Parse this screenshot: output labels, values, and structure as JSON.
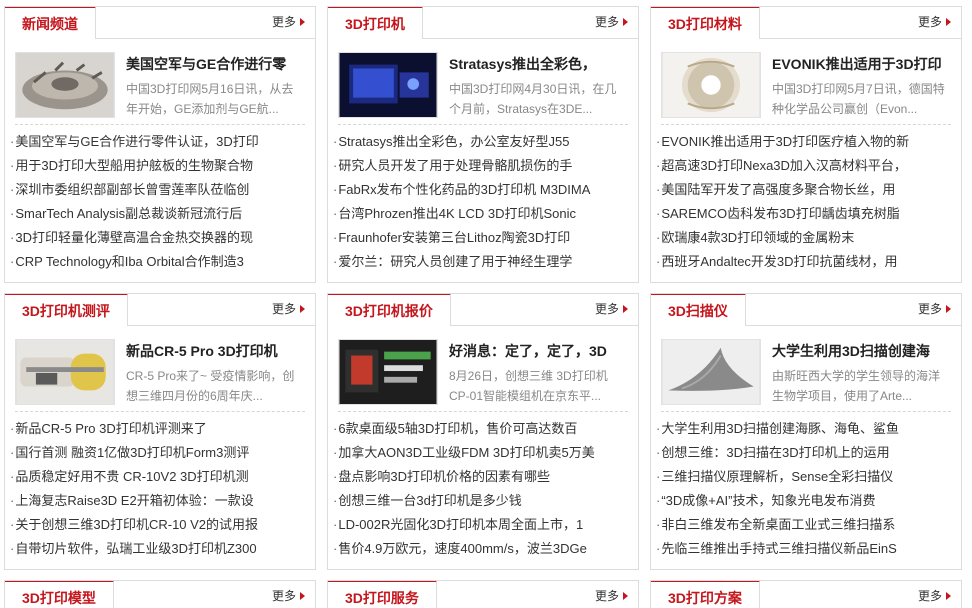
{
  "more_label": "更多",
  "panels": [
    {
      "title": "新闻频道",
      "feature": {
        "title": "美国空军与GE合作进行零",
        "summary": "中国3D打印网5月16日讯，从去年开始，GE添加剂与GE航..."
      },
      "items": [
        "美国空军与GE合作进行零件认证，3D打印",
        "用于3D打印大型船用护舷板的生物聚合物",
        "深圳市委组织部副部长曾雪莲率队莅临创",
        "SmarTech Analysis副总裁谈新冠流行后",
        "3D打印轻量化薄壁高温合金热交换器的现",
        "CRP Technology和Iba Orbital合作制造3"
      ]
    },
    {
      "title": "3D打印机",
      "feature": {
        "title": "Stratasys推出全彩色，",
        "summary": "中国3D打印网4月30日讯，在几个月前，Stratasys在3DE..."
      },
      "items": [
        "Stratasys推出全彩色，办公室友好型J55",
        "研究人员开发了用于处理骨骼肌损伤的手",
        "FabRx发布个性化药品的3D打印机 M3DIMA",
        "台湾Phrozen推出4K LCD 3D打印机Sonic",
        "Fraunhofer安装第三台Lithoz陶瓷3D打印",
        "爱尔兰：研究人员创建了用于神经生理学"
      ]
    },
    {
      "title": "3D打印材料",
      "feature": {
        "title": "EVONIK推出适用于3D打印",
        "summary": "中国3D打印网5月7日讯，德国特种化学品公司赢创（Evon..."
      },
      "items": [
        "EVONIK推出适用于3D打印医疗植入物的新",
        "超高速3D打印Nexa3D加入汉高材料平台，",
        "美国陆军开发了高强度多聚合物长丝，用",
        "SAREMCO齿科发布3D打印龋齿填充树脂",
        "欧瑞康4款3D打印领域的金属粉末",
        "西班牙Andaltec开发3D打印抗菌线材，用"
      ]
    },
    {
      "title": "3D打印机测评",
      "feature": {
        "title": "新品CR-5 Pro 3D打印机",
        "summary": "CR-5 Pro来了~ 受疫情影响，创想三维四月份的6周年庆..."
      },
      "items": [
        "新品CR-5 Pro 3D打印机评测来了",
        "国行首测 融资1亿做3D打印机Form3测评",
        "品质稳定好用不贵 CR-10V2 3D打印机测",
        "上海复志Raise3D E2开箱初体验：一款设",
        "关于创想三维3D打印机CR-10 V2的试用报",
        "自带切片软件，弘瑞工业级3D打印机Z300"
      ]
    },
    {
      "title": "3D打印机报价",
      "feature": {
        "title": "好消息：定了，定了，3D",
        "summary": "8月26日，创想三维 3D打印机CP-01智能模组机在京东平..."
      },
      "items": [
        "6款桌面级5轴3D打印机，售价可高达数百",
        "加拿大AON3D工业级FDM 3D打印机卖5万美",
        "盘点影响3D打印机价格的因素有哪些",
        "创想三维一台3d打印机是多少钱",
        "LD-002R光固化3D打印机本周全面上市，1",
        "售价4.9万欧元，速度400mm/s，波兰3DGe"
      ]
    },
    {
      "title": "3D扫描仪",
      "feature": {
        "title": "大学生利用3D扫描创建海",
        "summary": "由斯旺西大学的学生领导的海洋生物学项目，使用了Arte..."
      },
      "items": [
        "大学生利用3D扫描创建海豚、海龟、鲨鱼",
        "创想三维：3D扫描在3D打印机上的运用",
        "三维扫描仪原理解析，Sense全彩扫描仪",
        "“3D成像+AI”技术，知象光电发布消费",
        "非白三维发布全新桌面工业式三维扫描系",
        "先临三维推出手持式三维扫描仪新品EinS"
      ]
    },
    {
      "title": "3D打印模型"
    },
    {
      "title": "3D打印服务"
    },
    {
      "title": "3D打印方案"
    }
  ]
}
